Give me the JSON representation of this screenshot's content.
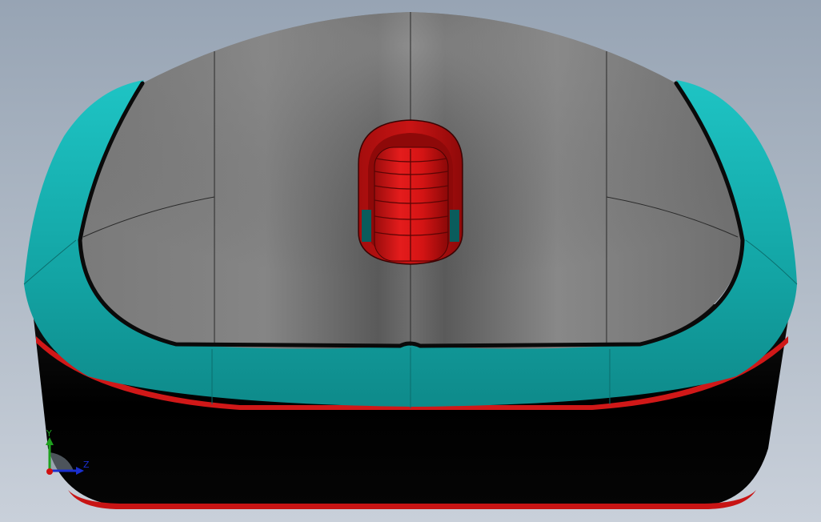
{
  "viewport": {
    "background_top": "#97a4b4",
    "background_bottom": "#c9d0da"
  },
  "model": {
    "colors": {
      "shell": "#000000",
      "top_cover": "#5f5f5f",
      "grip": "#13a8a8",
      "wheel": "#c81010",
      "edge_accent": "#d01818"
    }
  },
  "triad": {
    "y_label": "Y",
    "z_label": "Z",
    "colors": {
      "y": "#1fa01f",
      "z": "#1a2fd0",
      "x": "#d01010"
    }
  }
}
